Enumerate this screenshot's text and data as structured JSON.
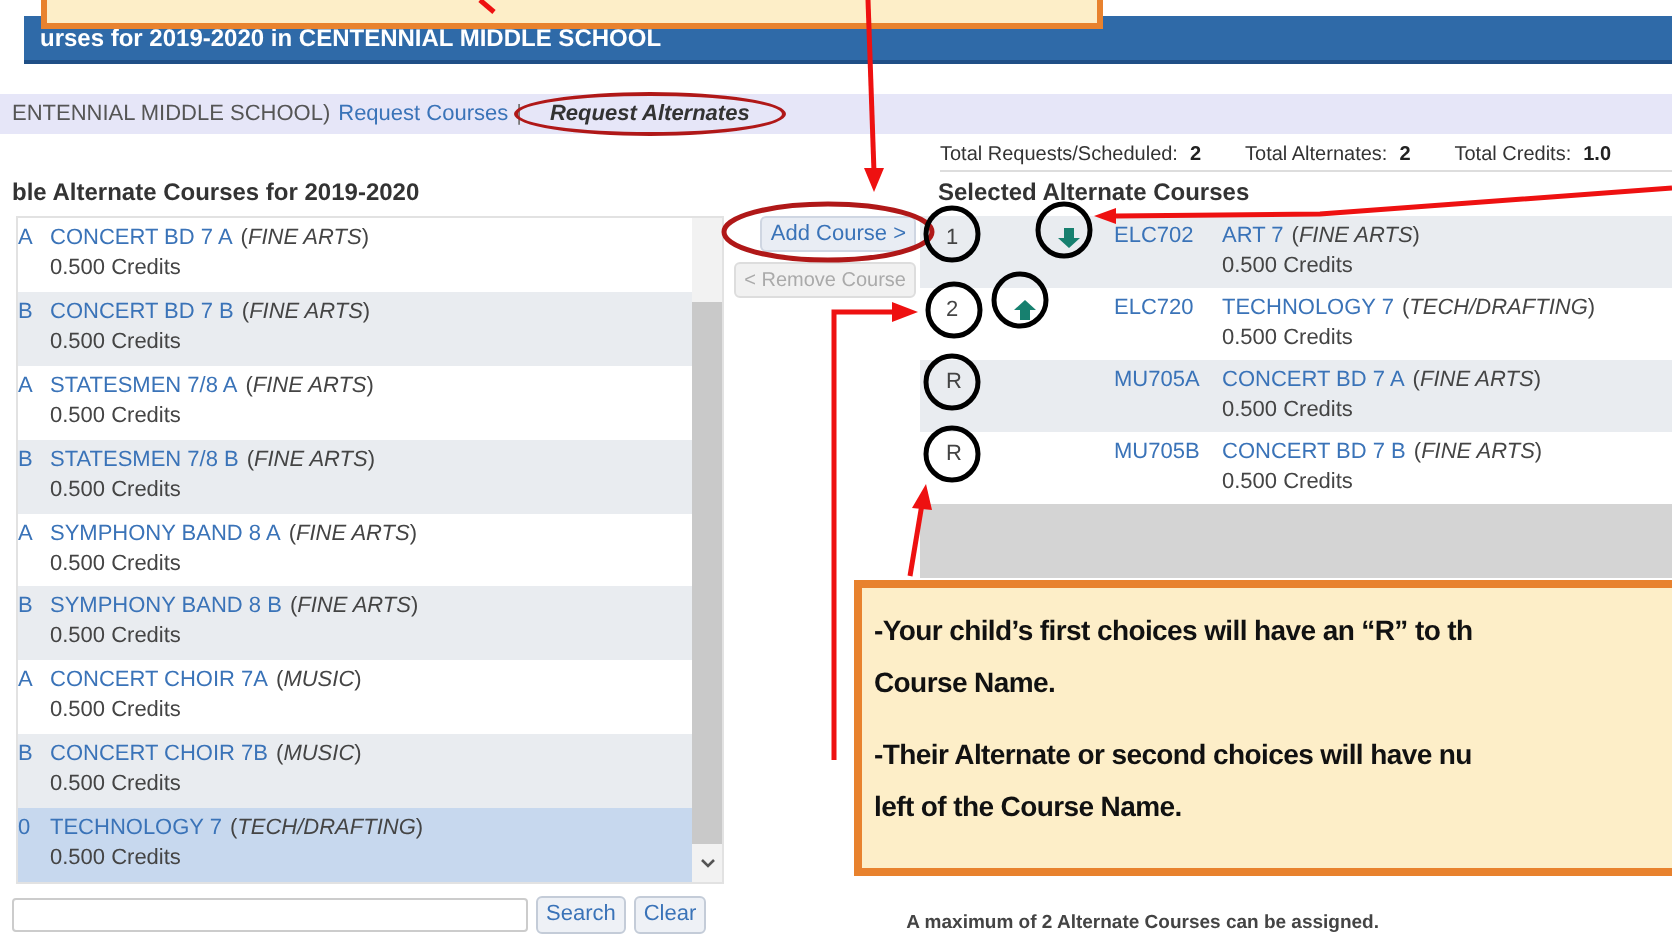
{
  "header": {
    "title": "urses for 2019-2020 in CENTENNIAL MIDDLE SCHOOL"
  },
  "breadcrumb": {
    "school": "ENTENNIAL MIDDLE SCHOOL)",
    "separator": "|",
    "links": [
      {
        "label": "Request Courses",
        "selected": false
      },
      {
        "label": "Request Alternates",
        "selected": true
      }
    ]
  },
  "totals": [
    {
      "label": "Total Requests/Scheduled:",
      "value": "2"
    },
    {
      "label": "Total Alternates:",
      "value": "2"
    },
    {
      "label": "Total Credits:",
      "value": "1.0"
    }
  ],
  "available": {
    "heading": "ble Alternate Courses for 2019-2020",
    "courses": [
      {
        "code": "A",
        "title": "CONCERT BD 7 A",
        "department": "(*FINE ARTS*)",
        "credits": "0.500 Credits",
        "selected": false
      },
      {
        "code": "B",
        "title": "CONCERT BD 7 B",
        "department": "(*FINE ARTS*)",
        "credits": "0.500 Credits",
        "selected": false
      },
      {
        "code": "A",
        "title": "STATESMEN 7/8 A",
        "department": "(*FINE ARTS*)",
        "credits": "0.500 Credits",
        "selected": false
      },
      {
        "code": "B",
        "title": "STATESMEN 7/8 B",
        "department": "(*FINE ARTS*)",
        "credits": "0.500 Credits",
        "selected": false
      },
      {
        "code": "A",
        "title": "SYMPHONY BAND 8 A",
        "department": "(*FINE ARTS*)",
        "credits": "0.500 Credits",
        "selected": false
      },
      {
        "code": "B",
        "title": "SYMPHONY BAND 8 B",
        "department": "(*FINE ARTS*)",
        "credits": "0.500 Credits",
        "selected": false
      },
      {
        "code": "A",
        "title": "CONCERT CHOIR 7A",
        "department": "(*MUSIC*)",
        "credits": "0.500 Credits",
        "selected": false
      },
      {
        "code": "B",
        "title": "CONCERT CHOIR 7B",
        "department": "(*MUSIC*)",
        "credits": "0.500 Credits",
        "selected": false
      },
      {
        "code": "0",
        "title": "TECHNOLOGY 7",
        "department": "(*TECH/DRAFTING*)",
        "credits": "0.500 Credits",
        "selected": true
      }
    ]
  },
  "actions": [
    {
      "label": "Add Course >",
      "disabled": false
    },
    {
      "label": "< Remove Course",
      "disabled": true
    }
  ],
  "search": {
    "buttons": [
      "Search",
      "Clear"
    ]
  },
  "selected": {
    "heading": "Selected Alternate Courses",
    "courses": [
      {
        "rank": "1",
        "move_up": false,
        "move_down": true,
        "code": "ELC702",
        "title": "ART 7",
        "department": "(*FINE ARTS*)",
        "credits": "0.500 Credits"
      },
      {
        "rank": "2",
        "move_up": true,
        "move_down": false,
        "code": "ELC720",
        "title": "TECHNOLOGY 7",
        "department": "(*TECH/DRAFTING*)",
        "credits": "0.500 Credits"
      },
      {
        "rank": "R",
        "move_up": false,
        "move_down": false,
        "code": "MU705A",
        "title": "CONCERT BD 7 A",
        "department": "(*FINE ARTS*)",
        "credits": "0.500 Credits"
      },
      {
        "rank": "R",
        "move_up": false,
        "move_down": false,
        "code": "MU705B",
        "title": "CONCERT BD 7 B",
        "department": "(*FINE ARTS*)",
        "credits": "0.500 Credits"
      }
    ]
  },
  "note": "A maximum of 2 Alternate Courses can be assigned.",
  "callout": {
    "lines": [
      "-Your child’s first choices will have an “R” to th",
      "Course Name.",
      "-Their Alternate or second choices will have nu",
      "left of the Course Name."
    ]
  }
}
